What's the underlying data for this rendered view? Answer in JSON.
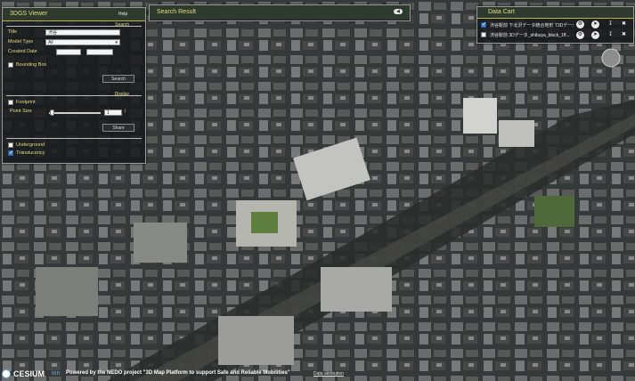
{
  "viewer": {
    "title": "3DGS Viewer",
    "help_label": "Help",
    "search_section": "Search",
    "fields": [
      {
        "label": "Title",
        "value": "渋谷"
      },
      {
        "label": "Model Type",
        "value": "All"
      },
      {
        "label": "Created Date",
        "value": ""
      }
    ],
    "bbox_label": "Bounding Box",
    "search_button": "Search",
    "display_section": "Display",
    "footprint_label": "Footprint",
    "point_size_label": "Point Size",
    "point_size_value": "1",
    "share_button": "Share",
    "underground_label": "Underground",
    "translucency_label": "Translucency"
  },
  "search_result": {
    "title": "Search Result"
  },
  "data_cart": {
    "title": "Data Cart",
    "items": [
      {
        "label": "渋谷駅前 下北沢データ統合地形 T3Dデータ"
      },
      {
        "label": "渋谷駅前 3Dデータ_shibuya_block_1ff..."
      }
    ]
  },
  "footer": {
    "logo_text": "CESIUM",
    "logo_suffix": "ion",
    "credit": "Powered by the NEDO project \"3D Map Platform to support Safe and Reliable Mobilities\"",
    "attribution_link": "Data attribution"
  },
  "colors": {
    "panel_bg": "#181a1c",
    "header_accent": "#e6dc7a",
    "checkbox_on": "#3f7fd6"
  }
}
